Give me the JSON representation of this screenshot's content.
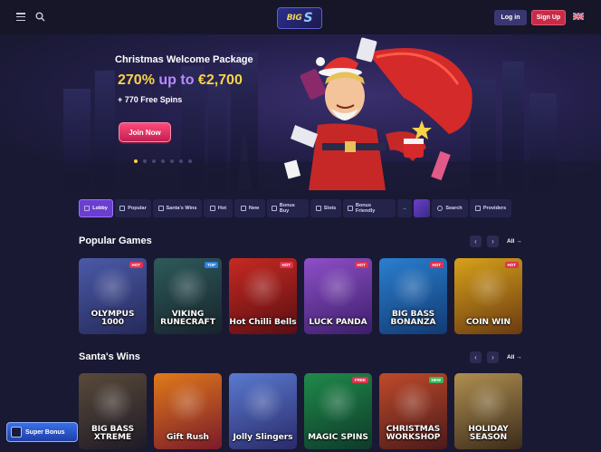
{
  "header": {
    "logo_text": "BIG",
    "logo_s": "S",
    "login_label": "Log in",
    "signup_label": "Sign Up"
  },
  "hero": {
    "title": "Christmas Welcome Package",
    "amount_pre": "270% ",
    "amount_mid": "up to",
    "amount_post": " €2,700",
    "spins": "+ 770 Free Spins",
    "cta": "Join Now"
  },
  "categories": [
    {
      "label": "Lobby",
      "icon": "lobby-icon"
    },
    {
      "label": "Popular",
      "icon": "star-icon"
    },
    {
      "label": "Santa's Wins",
      "icon": "santa-icon"
    },
    {
      "label": "Hot",
      "icon": "fire-icon"
    },
    {
      "label": "New",
      "icon": "new-icon"
    },
    {
      "label": "Bonus Buy",
      "icon": "bonus-buy-icon"
    },
    {
      "label": "Slots",
      "icon": "slots-icon"
    },
    {
      "label": "Bonus Friendly",
      "icon": "bonus-friendly-icon"
    },
    {
      "label": "Search",
      "icon": "search-icon"
    },
    {
      "label": "Providers",
      "icon": "providers-icon"
    }
  ],
  "popular": {
    "title": "Popular Games",
    "all_label": "All",
    "games": [
      {
        "name": "OLYMPUS 1000",
        "badge": "HOT",
        "bg": "#4b5aa8",
        "bg2": "#252a5a"
      },
      {
        "name": "VIKING RUNECRAFT",
        "badge": "TOP",
        "bg": "#2e5a5a",
        "bg2": "#16242c"
      },
      {
        "name": "Hot Chilli Bells",
        "badge": "HOT",
        "bg": "#c62a22",
        "bg2": "#5a0e12"
      },
      {
        "name": "LUCK PANDA",
        "badge": "HOT",
        "bg": "#8e4fc8",
        "bg2": "#3c1e6a"
      },
      {
        "name": "BIG BASS BONANZA",
        "badge": "HOT",
        "bg": "#2a7fd0",
        "bg2": "#123a72"
      },
      {
        "name": "COIN WIN",
        "badge": "HOT",
        "bg": "#d7a11a",
        "bg2": "#6a3a10"
      }
    ]
  },
  "santas": {
    "title": "Santa's Wins",
    "all_label": "All",
    "games": [
      {
        "name": "BIG BASS XTREME",
        "badge": "",
        "bg": "#5a4a3a",
        "bg2": "#1e1a26"
      },
      {
        "name": "Gift Rush",
        "badge": "",
        "bg": "#e07a1a",
        "bg2": "#7a1a2a"
      },
      {
        "name": "Jolly Slingers",
        "badge": "",
        "bg": "#5a7ad0",
        "bg2": "#2a2a6a"
      },
      {
        "name": "MAGIC SPINS",
        "badge": "FREE",
        "bg": "#1f8a4a",
        "bg2": "#0e3a2a"
      },
      {
        "name": "CHRISTMAS WORKSHOP",
        "badge": "NEW",
        "bg": "#c04a2a",
        "bg2": "#4a1a1a"
      },
      {
        "name": "HOLIDAY SEASON",
        "badge": "",
        "bg": "#b09050",
        "bg2": "#3a2a1a"
      }
    ]
  },
  "super_bonus": "Super Bonus",
  "colors": {
    "background": "#1a1933",
    "accent": "#6a3fd0",
    "signup": "#c62c48",
    "gold": "#f7d348"
  }
}
